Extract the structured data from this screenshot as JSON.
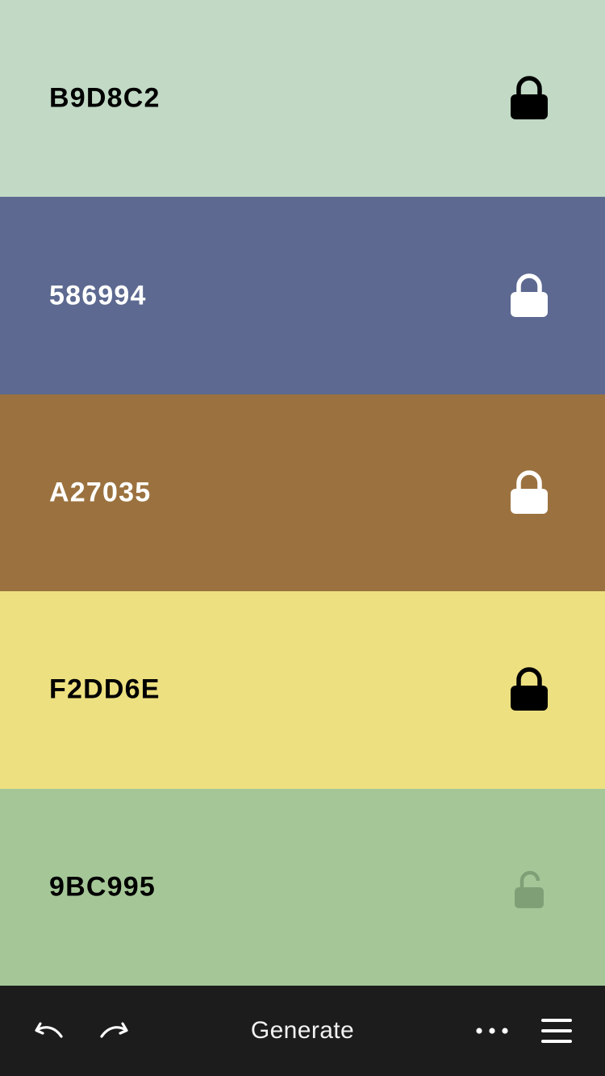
{
  "palette": [
    {
      "hex": "B9D8C2",
      "bg": "#c1d9c5",
      "text_color": "#000000",
      "lock_state": "locked",
      "lock_color": "#000000"
    },
    {
      "hex": "586994",
      "bg": "#5d6990",
      "text_color": "#ffffff",
      "lock_state": "locked",
      "lock_color": "#ffffff"
    },
    {
      "hex": "A27035",
      "bg": "#9b723f",
      "text_color": "#ffffff",
      "lock_state": "locked",
      "lock_color": "#ffffff"
    },
    {
      "hex": "F2DD6E",
      "bg": "#ede080",
      "text_color": "#000000",
      "lock_state": "locked",
      "lock_color": "#000000"
    },
    {
      "hex": "9BC995",
      "bg": "#a5c798",
      "text_color": "#000000",
      "lock_state": "unlocked",
      "lock_color": "#7fa077"
    }
  ],
  "toolbar": {
    "undo_icon": "undo-icon",
    "redo_icon": "redo-icon",
    "generate_label": "Generate",
    "more_icon": "more-icon",
    "menu_icon": "menu-icon",
    "background": "#1c1c1c"
  }
}
